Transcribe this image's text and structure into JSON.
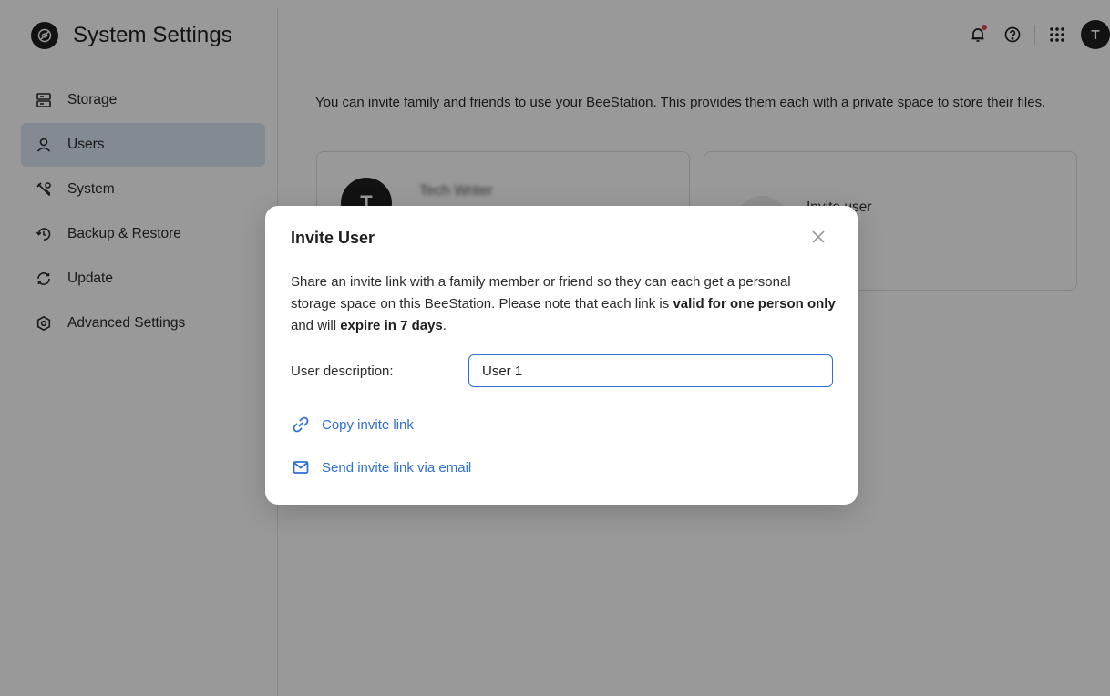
{
  "app": {
    "title": "System Settings"
  },
  "sidebar": {
    "items": [
      {
        "label": "Storage",
        "icon": "storage-icon",
        "active": false
      },
      {
        "label": "Users",
        "icon": "user-icon",
        "active": true
      },
      {
        "label": "System",
        "icon": "tools-icon",
        "active": false
      },
      {
        "label": "Backup & Restore",
        "icon": "backup-icon",
        "active": false
      },
      {
        "label": "Update",
        "icon": "update-icon",
        "active": false
      },
      {
        "label": "Advanced Settings",
        "icon": "advanced-settings-icon",
        "active": false
      }
    ]
  },
  "topbar": {
    "avatar_initial": "T",
    "icons": [
      "bell-icon",
      "help-icon",
      "apps-grid-icon"
    ]
  },
  "main": {
    "intro": "You can invite family and friends to use your BeeStation. This provides them each with a private space to store their files.",
    "user_card": {
      "avatar_initial": "T",
      "name": "Tech Writer"
    },
    "invite_card": {
      "label": "Invite user",
      "sub": ")"
    }
  },
  "modal": {
    "title": "Invite User",
    "body_part1": "Share an invite link with a family member or friend so they can each get a personal storage space on this BeeStation. Please note that each link is ",
    "body_bold1": "valid for one person only",
    "body_part2": " and will ",
    "body_bold2": "expire in 7 days",
    "body_part3": ".",
    "field_label": "User description:",
    "field_value": "User 1",
    "copy_link_label": "Copy invite link",
    "email_link_label": "Send invite link via email"
  },
  "colors": {
    "accent": "#2f6fd6",
    "active_nav_bg": "#dde6f2",
    "overlay": "rgba(0,0,0,0.40)",
    "notification_dot": "#e5484d"
  }
}
